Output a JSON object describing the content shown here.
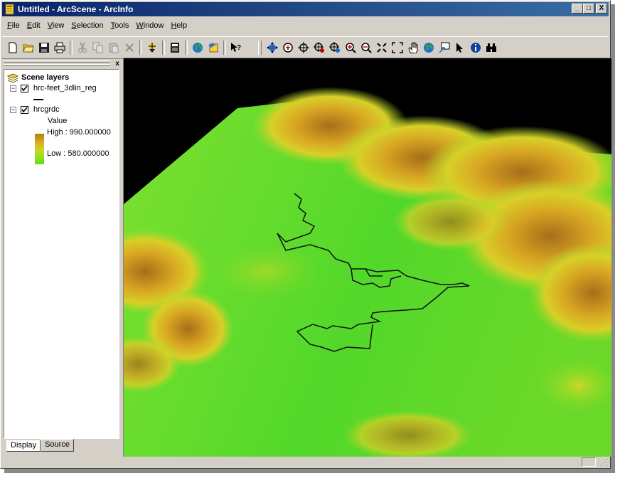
{
  "window": {
    "title": "Untitled - ArcScene - ArcInfo",
    "controls": {
      "minimize": "_",
      "maximize": "□",
      "close": "X"
    }
  },
  "menu": {
    "items": [
      {
        "label": "File",
        "mnemonic": "F",
        "rest": "ile"
      },
      {
        "label": "Edit",
        "mnemonic": "E",
        "rest": "dit"
      },
      {
        "label": "View",
        "mnemonic": "V",
        "rest": "iew"
      },
      {
        "label": "Selection",
        "mnemonic": "S",
        "rest": "election"
      },
      {
        "label": "Tools",
        "mnemonic": "T",
        "rest": "ools"
      },
      {
        "label": "Window",
        "mnemonic": "W",
        "rest": "indow"
      },
      {
        "label": "Help",
        "mnemonic": "H",
        "rest": "elp"
      }
    ]
  },
  "toolbars": {
    "standard": [
      "new-document-icon",
      "open-folder-icon",
      "save-icon",
      "print-icon",
      "cut-icon",
      "copy-icon",
      "paste-icon",
      "delete-icon",
      "add-data-icon",
      "calculator-icon",
      "arctoolbox-globe-icon",
      "layer-properties-icon",
      "whats-this-help-icon"
    ],
    "tools": [
      "navigate-icon",
      "zoom-in-out-icon",
      "target-icon",
      "center-on-target-icon",
      "zoom-to-target-icon",
      "zoom-in-icon",
      "zoom-out-icon",
      "fixed-zoom-in-icon",
      "full-extent-icon",
      "pan-hand-icon",
      "globe-full-extent-icon",
      "set-observer-icon",
      "select-arrow-icon",
      "identify-icon",
      "find-binoculars-icon"
    ]
  },
  "toc": {
    "close_label": "x",
    "root_label": "Scene layers",
    "layers": [
      {
        "name": "hrc-feet_3dlin_reg",
        "checked": true,
        "expander": "−"
      },
      {
        "name": "hrcgrdc",
        "checked": true,
        "expander": "−"
      }
    ],
    "legend": {
      "field": "Value",
      "high": "High : 990.000000",
      "low": "Low : 580.000000",
      "colors": {
        "high": "#b87c1a",
        "mid": "#d8b020",
        "low": "#60e020"
      }
    },
    "tabs": {
      "display": "Display",
      "source": "Source",
      "active": "display"
    }
  },
  "scene": {
    "background": "#000000",
    "terrain_low": "#5ee020",
    "terrain_high": "#b8801c"
  }
}
